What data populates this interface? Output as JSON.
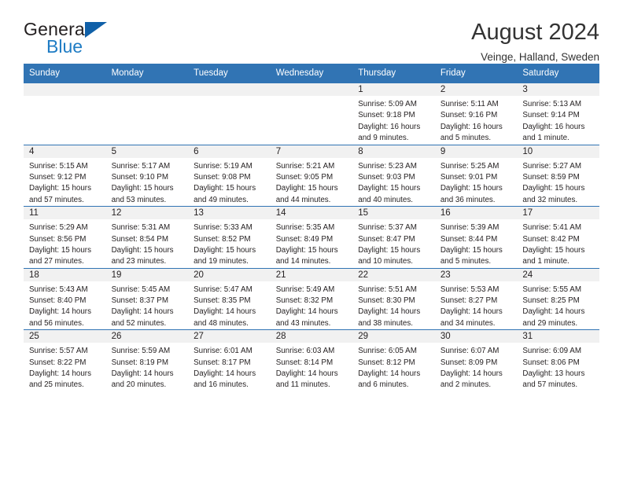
{
  "brand": {
    "name_part1": "General",
    "name_part2": "Blue",
    "triangle_color": "#1060a8",
    "blue_color": "#1f7cc4"
  },
  "header": {
    "title": "August 2024",
    "location": "Veinge, Halland, Sweden"
  },
  "theme": {
    "header_bg": "#3174b4",
    "daynum_bg": "#f1f1f1",
    "grid_line": "#3174b4",
    "text": "#231f20"
  },
  "calendar": {
    "weekday_headers": [
      "Sunday",
      "Monday",
      "Tuesday",
      "Wednesday",
      "Thursday",
      "Friday",
      "Saturday"
    ],
    "weeks": [
      [
        {
          "empty": true
        },
        {
          "empty": true
        },
        {
          "empty": true
        },
        {
          "empty": true
        },
        {
          "day": "1",
          "sunrise": "Sunrise: 5:09 AM",
          "sunset": "Sunset: 9:18 PM",
          "daylight_line1": "Daylight: 16 hours",
          "daylight_line2": "and 9 minutes."
        },
        {
          "day": "2",
          "sunrise": "Sunrise: 5:11 AM",
          "sunset": "Sunset: 9:16 PM",
          "daylight_line1": "Daylight: 16 hours",
          "daylight_line2": "and 5 minutes."
        },
        {
          "day": "3",
          "sunrise": "Sunrise: 5:13 AM",
          "sunset": "Sunset: 9:14 PM",
          "daylight_line1": "Daylight: 16 hours",
          "daylight_line2": "and 1 minute."
        }
      ],
      [
        {
          "day": "4",
          "sunrise": "Sunrise: 5:15 AM",
          "sunset": "Sunset: 9:12 PM",
          "daylight_line1": "Daylight: 15 hours",
          "daylight_line2": "and 57 minutes."
        },
        {
          "day": "5",
          "sunrise": "Sunrise: 5:17 AM",
          "sunset": "Sunset: 9:10 PM",
          "daylight_line1": "Daylight: 15 hours",
          "daylight_line2": "and 53 minutes."
        },
        {
          "day": "6",
          "sunrise": "Sunrise: 5:19 AM",
          "sunset": "Sunset: 9:08 PM",
          "daylight_line1": "Daylight: 15 hours",
          "daylight_line2": "and 49 minutes."
        },
        {
          "day": "7",
          "sunrise": "Sunrise: 5:21 AM",
          "sunset": "Sunset: 9:05 PM",
          "daylight_line1": "Daylight: 15 hours",
          "daylight_line2": "and 44 minutes."
        },
        {
          "day": "8",
          "sunrise": "Sunrise: 5:23 AM",
          "sunset": "Sunset: 9:03 PM",
          "daylight_line1": "Daylight: 15 hours",
          "daylight_line2": "and 40 minutes."
        },
        {
          "day": "9",
          "sunrise": "Sunrise: 5:25 AM",
          "sunset": "Sunset: 9:01 PM",
          "daylight_line1": "Daylight: 15 hours",
          "daylight_line2": "and 36 minutes."
        },
        {
          "day": "10",
          "sunrise": "Sunrise: 5:27 AM",
          "sunset": "Sunset: 8:59 PM",
          "daylight_line1": "Daylight: 15 hours",
          "daylight_line2": "and 32 minutes."
        }
      ],
      [
        {
          "day": "11",
          "sunrise": "Sunrise: 5:29 AM",
          "sunset": "Sunset: 8:56 PM",
          "daylight_line1": "Daylight: 15 hours",
          "daylight_line2": "and 27 minutes."
        },
        {
          "day": "12",
          "sunrise": "Sunrise: 5:31 AM",
          "sunset": "Sunset: 8:54 PM",
          "daylight_line1": "Daylight: 15 hours",
          "daylight_line2": "and 23 minutes."
        },
        {
          "day": "13",
          "sunrise": "Sunrise: 5:33 AM",
          "sunset": "Sunset: 8:52 PM",
          "daylight_line1": "Daylight: 15 hours",
          "daylight_line2": "and 19 minutes."
        },
        {
          "day": "14",
          "sunrise": "Sunrise: 5:35 AM",
          "sunset": "Sunset: 8:49 PM",
          "daylight_line1": "Daylight: 15 hours",
          "daylight_line2": "and 14 minutes."
        },
        {
          "day": "15",
          "sunrise": "Sunrise: 5:37 AM",
          "sunset": "Sunset: 8:47 PM",
          "daylight_line1": "Daylight: 15 hours",
          "daylight_line2": "and 10 minutes."
        },
        {
          "day": "16",
          "sunrise": "Sunrise: 5:39 AM",
          "sunset": "Sunset: 8:44 PM",
          "daylight_line1": "Daylight: 15 hours",
          "daylight_line2": "and 5 minutes."
        },
        {
          "day": "17",
          "sunrise": "Sunrise: 5:41 AM",
          "sunset": "Sunset: 8:42 PM",
          "daylight_line1": "Daylight: 15 hours",
          "daylight_line2": "and 1 minute."
        }
      ],
      [
        {
          "day": "18",
          "sunrise": "Sunrise: 5:43 AM",
          "sunset": "Sunset: 8:40 PM",
          "daylight_line1": "Daylight: 14 hours",
          "daylight_line2": "and 56 minutes."
        },
        {
          "day": "19",
          "sunrise": "Sunrise: 5:45 AM",
          "sunset": "Sunset: 8:37 PM",
          "daylight_line1": "Daylight: 14 hours",
          "daylight_line2": "and 52 minutes."
        },
        {
          "day": "20",
          "sunrise": "Sunrise: 5:47 AM",
          "sunset": "Sunset: 8:35 PM",
          "daylight_line1": "Daylight: 14 hours",
          "daylight_line2": "and 48 minutes."
        },
        {
          "day": "21",
          "sunrise": "Sunrise: 5:49 AM",
          "sunset": "Sunset: 8:32 PM",
          "daylight_line1": "Daylight: 14 hours",
          "daylight_line2": "and 43 minutes."
        },
        {
          "day": "22",
          "sunrise": "Sunrise: 5:51 AM",
          "sunset": "Sunset: 8:30 PM",
          "daylight_line1": "Daylight: 14 hours",
          "daylight_line2": "and 38 minutes."
        },
        {
          "day": "23",
          "sunrise": "Sunrise: 5:53 AM",
          "sunset": "Sunset: 8:27 PM",
          "daylight_line1": "Daylight: 14 hours",
          "daylight_line2": "and 34 minutes."
        },
        {
          "day": "24",
          "sunrise": "Sunrise: 5:55 AM",
          "sunset": "Sunset: 8:25 PM",
          "daylight_line1": "Daylight: 14 hours",
          "daylight_line2": "and 29 minutes."
        }
      ],
      [
        {
          "day": "25",
          "sunrise": "Sunrise: 5:57 AM",
          "sunset": "Sunset: 8:22 PM",
          "daylight_line1": "Daylight: 14 hours",
          "daylight_line2": "and 25 minutes."
        },
        {
          "day": "26",
          "sunrise": "Sunrise: 5:59 AM",
          "sunset": "Sunset: 8:19 PM",
          "daylight_line1": "Daylight: 14 hours",
          "daylight_line2": "and 20 minutes."
        },
        {
          "day": "27",
          "sunrise": "Sunrise: 6:01 AM",
          "sunset": "Sunset: 8:17 PM",
          "daylight_line1": "Daylight: 14 hours",
          "daylight_line2": "and 16 minutes."
        },
        {
          "day": "28",
          "sunrise": "Sunrise: 6:03 AM",
          "sunset": "Sunset: 8:14 PM",
          "daylight_line1": "Daylight: 14 hours",
          "daylight_line2": "and 11 minutes."
        },
        {
          "day": "29",
          "sunrise": "Sunrise: 6:05 AM",
          "sunset": "Sunset: 8:12 PM",
          "daylight_line1": "Daylight: 14 hours",
          "daylight_line2": "and 6 minutes."
        },
        {
          "day": "30",
          "sunrise": "Sunrise: 6:07 AM",
          "sunset": "Sunset: 8:09 PM",
          "daylight_line1": "Daylight: 14 hours",
          "daylight_line2": "and 2 minutes."
        },
        {
          "day": "31",
          "sunrise": "Sunrise: 6:09 AM",
          "sunset": "Sunset: 8:06 PM",
          "daylight_line1": "Daylight: 13 hours",
          "daylight_line2": "and 57 minutes."
        }
      ]
    ]
  }
}
